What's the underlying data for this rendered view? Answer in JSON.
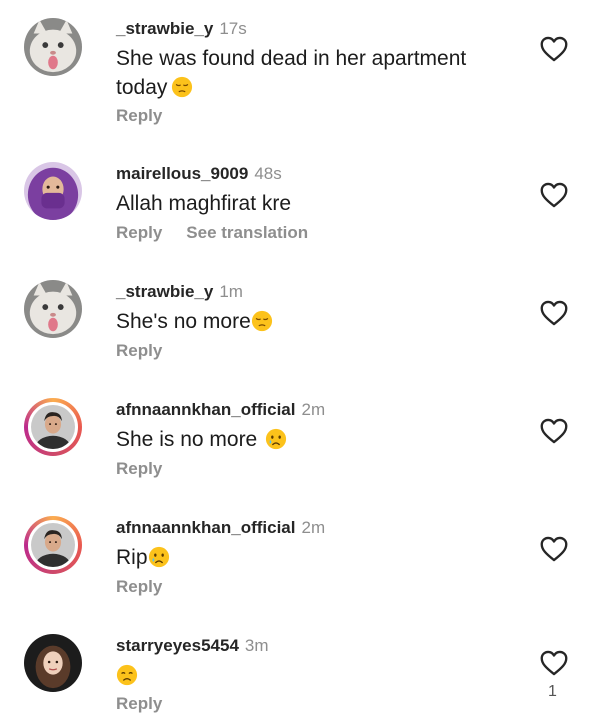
{
  "comments": [
    {
      "username": "_strawbie_y",
      "time": "17s",
      "text_line1": "She was found dead in her apartment",
      "text_line2": "today",
      "text_emoji": "pensive-face-emoji",
      "reply": "Reply",
      "avatar": "cat-avatar"
    },
    {
      "username": "mairellous_9009",
      "time": "48s",
      "text": "Allah maghfirat kre",
      "reply": "Reply",
      "translate": "See translation",
      "avatar": "hijab-avatar"
    },
    {
      "username": "_strawbie_y",
      "time": "1m",
      "text": "She's no more",
      "text_emoji": "pensive-face-emoji",
      "reply": "Reply",
      "avatar": "cat-avatar"
    },
    {
      "username": "afnnaannkhan_official",
      "time": "2m",
      "text": "She is no more",
      "text_emoji": "crying-face-emoji",
      "reply": "Reply",
      "avatar": "man-avatar-story-ring"
    },
    {
      "username": "afnnaannkhan_official",
      "time": "2m",
      "text": "Rip",
      "text_emoji": "crying-face-emoji",
      "reply": "Reply",
      "avatar": "man-avatar-story-ring"
    },
    {
      "username": "starryeyes5454",
      "time": "3m",
      "text": "",
      "text_emoji": "sad-face-emoji",
      "reply": "Reply",
      "like_count": "1",
      "avatar": "girl-avatar"
    }
  ],
  "icons": {
    "like": "heart-outline-icon"
  },
  "colors": {
    "username": "#262626",
    "muted": "#8e8e8e",
    "ring_start": "#fbad50",
    "ring_end": "#bc2a8d",
    "emoji": "#fcc21b"
  }
}
